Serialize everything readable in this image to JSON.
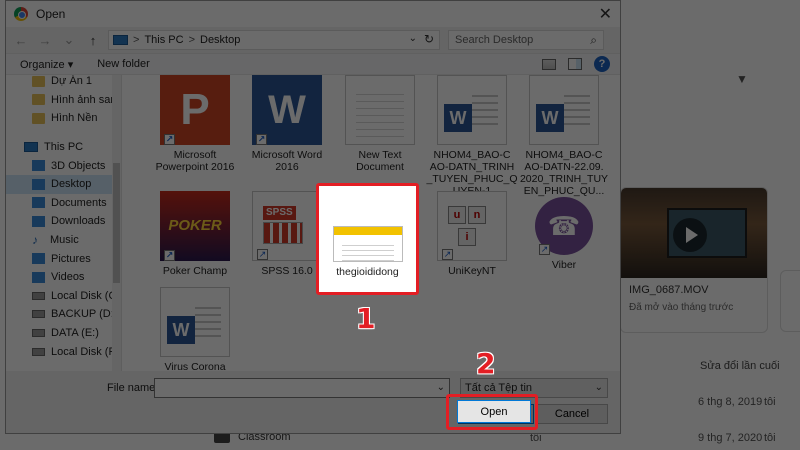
{
  "dialog": {
    "title": "Open",
    "close_glyph": "✕"
  },
  "nav": {
    "back_glyph": "←",
    "forward_glyph": "→",
    "recent_glyph": "⌄",
    "up_glyph": "↑",
    "address": [
      "This PC",
      "Desktop"
    ],
    "address_sep": ">",
    "search_placeholder": "Search Desktop"
  },
  "toolbar": {
    "organize": "Organize ▾",
    "new_folder": "New folder",
    "help": "?"
  },
  "sidebar": {
    "items": [
      {
        "label": "Dự Án 1",
        "icon": "folder-icon",
        "kind": "folder"
      },
      {
        "label": "Hình ảnh santiag",
        "icon": "folder-icon",
        "kind": "folder"
      },
      {
        "label": "Hình Nền",
        "icon": "folder-icon",
        "kind": "folder"
      },
      {
        "label": "This PC",
        "icon": "computer-icon",
        "kind": "pc"
      },
      {
        "label": "3D Objects",
        "icon": "cube-icon",
        "kind": "blue"
      },
      {
        "label": "Desktop",
        "icon": "desktop-icon",
        "kind": "blue",
        "selected": true
      },
      {
        "label": "Documents",
        "icon": "documents-icon",
        "kind": "blue"
      },
      {
        "label": "Downloads",
        "icon": "downloads-icon",
        "kind": "blue"
      },
      {
        "label": "Music",
        "icon": "music-icon",
        "kind": "music"
      },
      {
        "label": "Pictures",
        "icon": "pictures-icon",
        "kind": "blue"
      },
      {
        "label": "Videos",
        "icon": "videos-icon",
        "kind": "blue"
      },
      {
        "label": "Local Disk (C:)",
        "icon": "disk-icon",
        "kind": "disk"
      },
      {
        "label": "BACKUP (D:)",
        "icon": "disk-icon",
        "kind": "disk"
      },
      {
        "label": "DATA (E:)",
        "icon": "disk-icon",
        "kind": "disk"
      },
      {
        "label": "Local Disk (F:)",
        "icon": "disk-icon",
        "kind": "disk"
      }
    ]
  },
  "files": [
    {
      "label": "Microsoft\nPowerpoint 2016",
      "icon": "powerpoint-icon"
    },
    {
      "label": "Microsoft Word\n2016",
      "icon": "word-icon"
    },
    {
      "label": "New Text\nDocument",
      "icon": "text-document-icon"
    },
    {
      "label": "NHOM4_BAO-C\nAO-DATN_TRINH\n_TUYEN_PHUC_Q\nUYEN-1",
      "icon": "word-document-icon"
    },
    {
      "label": "NHOM4_BAO-C\nAO-DATN-22.09.\n2020_TRINH_TUY\nEN_PHUC_QU...",
      "icon": "word-document-icon"
    },
    {
      "label": "Poker Champ",
      "icon": "poker-icon"
    },
    {
      "label": "SPSS 16.0",
      "icon": "spss-icon"
    },
    {
      "label": "thegioididong",
      "icon": "image-thumbnail-icon",
      "selected": true
    },
    {
      "label": "UniKeyNT",
      "icon": "unikey-icon"
    },
    {
      "label": "Viber",
      "icon": "viber-icon"
    },
    {
      "label": "Virus Corona",
      "icon": "word-document-icon"
    }
  ],
  "file_icon_text": {
    "ppt": "P",
    "word": "W",
    "poker": "POKER",
    "spss": "SPSS",
    "unikey": [
      "u",
      "n",
      "i"
    ],
    "viber": "☎"
  },
  "footer": {
    "file_name_label": "File name:",
    "file_name_value": "",
    "file_type": "Tất cả Tệp tin",
    "open": "Open",
    "cancel": "Cancel",
    "dropdown_glyph": "⌄"
  },
  "annotations": {
    "step1": "1",
    "step2": "2",
    "highlight_color": "#e31e24"
  },
  "background": {
    "video_title": "IMG_0687.MOV",
    "video_subtitle": "Đã mở vào tháng trước",
    "column_header": "Sửa đổi lần cuối",
    "rows": [
      {
        "date": "6 thg 8, 2019",
        "owner": "tôi"
      },
      {
        "date": "9 thg 7, 2020",
        "owner": "tôi"
      }
    ],
    "folder_row": "Classroom",
    "folder_owner": "tôi"
  }
}
